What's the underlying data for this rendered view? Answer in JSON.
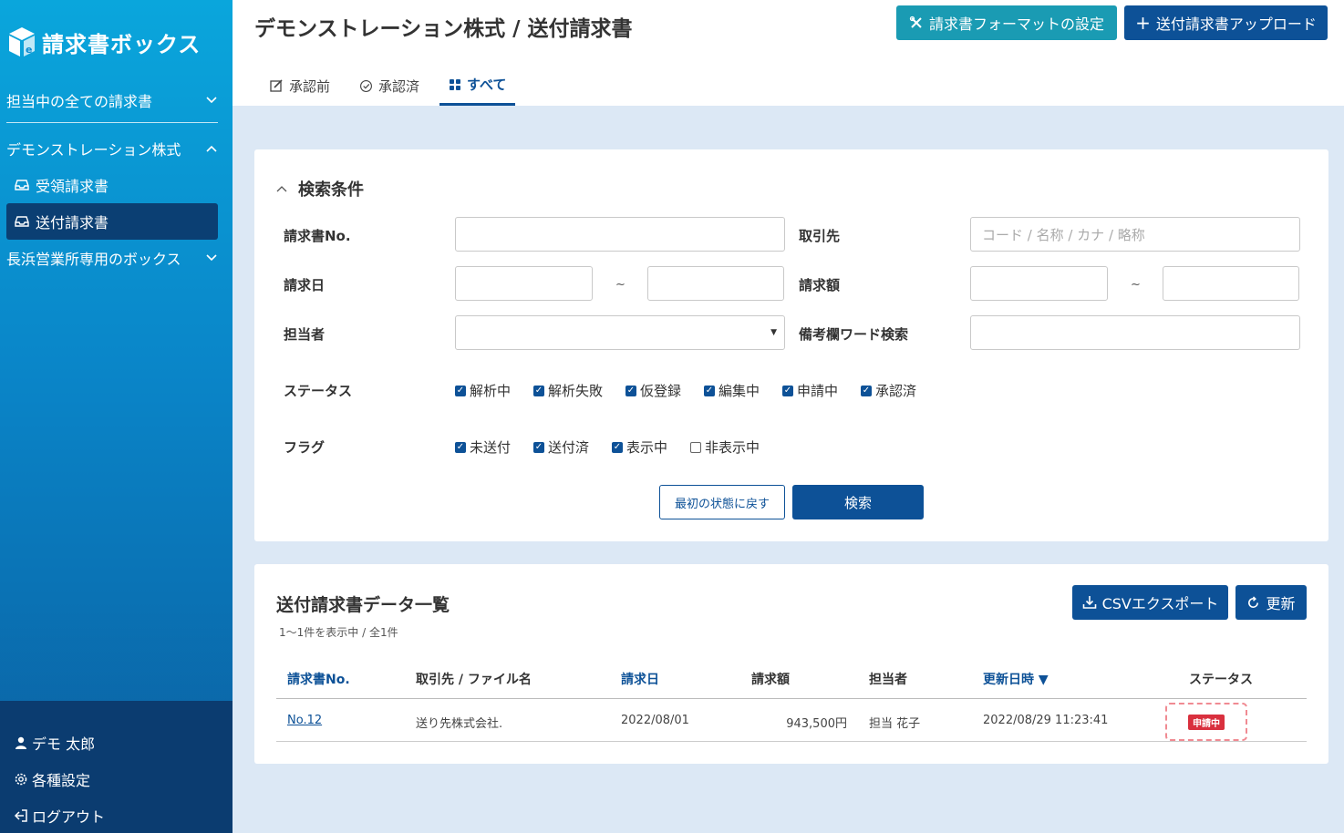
{
  "app": {
    "name": "請求書ボックス"
  },
  "sidebar": {
    "group_all": "担当中の全ての請求書",
    "group_company": "デモンストレーション株式",
    "items": [
      {
        "label": "受領請求書"
      },
      {
        "label": "送付請求書"
      }
    ],
    "group_branch": "長浜営業所専用のボックス",
    "user": "デモ 太郎",
    "settings": "各種設定",
    "logout": "ログアウト"
  },
  "header": {
    "title": "デモンストレーション株式 / 送付請求書",
    "format_button": "請求書フォーマットの設定",
    "upload_button": "送付請求書アップロード",
    "tabs": [
      {
        "label": "承認前"
      },
      {
        "label": "承認済"
      },
      {
        "label": "すべて"
      }
    ]
  },
  "search": {
    "title": "検索条件",
    "invoice_no_label": "請求書No.",
    "partner_label": "取引先",
    "partner_placeholder": "コード / 名称 / カナ / 略称",
    "date_label": "請求日",
    "amount_label": "請求額",
    "person_label": "担当者",
    "memo_label": "備考欄ワード検索",
    "status_label": "ステータス",
    "statuses": [
      {
        "label": "解析中",
        "checked": true
      },
      {
        "label": "解析失敗",
        "checked": true
      },
      {
        "label": "仮登録",
        "checked": true
      },
      {
        "label": "編集中",
        "checked": true
      },
      {
        "label": "申請中",
        "checked": true
      },
      {
        "label": "承認済",
        "checked": true
      }
    ],
    "flag_label": "フラグ",
    "flags": [
      {
        "label": "未送付",
        "checked": true
      },
      {
        "label": "送付済",
        "checked": true
      },
      {
        "label": "表示中",
        "checked": true
      },
      {
        "label": "非表示中",
        "checked": false
      }
    ],
    "reset_button": "最初の状態に戻す",
    "search_button": "検索",
    "tilde": "~"
  },
  "list": {
    "title": "送付請求書データ一覧",
    "count_text": "1〜1件を表示中 / 全1件",
    "csv_button": "CSVエクスポート",
    "refresh_button": "更新",
    "columns": [
      "請求書No.",
      "取引先 / ファイル名",
      "請求日",
      "請求額",
      "担当者",
      "更新日時 ▼",
      "ステータス"
    ],
    "rows": [
      {
        "no": "No.12",
        "partner": "送り先株式会社.",
        "date": "2022/08/01",
        "amount": "943,500円",
        "person": "担当 花子",
        "updated": "2022/08/29 11:23:41",
        "status": "申請中"
      }
    ]
  },
  "colors": {
    "navy": "#0d5197",
    "teal": "#1a9bb3",
    "status_red": "#d9303e"
  }
}
